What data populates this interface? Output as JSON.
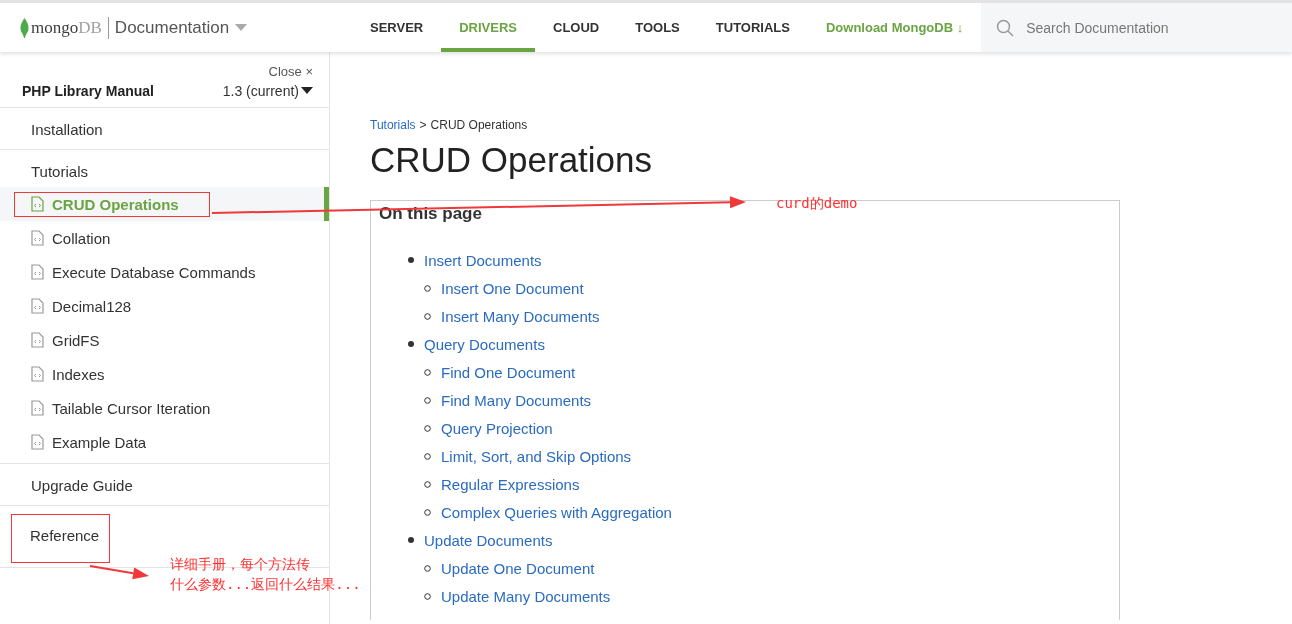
{
  "header": {
    "logo": {
      "word": "mongo",
      "suffix": "DB"
    },
    "section": "Documentation",
    "nav": [
      {
        "label": "SERVER",
        "selected": false
      },
      {
        "label": "DRIVERS",
        "selected": true
      },
      {
        "label": "CLOUD",
        "selected": false
      },
      {
        "label": "TOOLS",
        "selected": false
      },
      {
        "label": "TUTORIALS",
        "selected": false
      }
    ],
    "download": "Download MongoDB ↓",
    "search": {
      "placeholder": "Search Documentation"
    }
  },
  "sidebar": {
    "close": "Close ×",
    "title": "PHP Library Manual",
    "version": "1.3 (current)",
    "sections": [
      {
        "label": "Installation",
        "marked": false
      },
      {
        "label": "Tutorials",
        "marked": false,
        "children": [
          {
            "label": "CRUD Operations",
            "selected": true,
            "marked": true
          },
          {
            "label": "Collation",
            "selected": false,
            "marked": false
          },
          {
            "label": "Execute Database Commands",
            "selected": false,
            "marked": false
          },
          {
            "label": "Decimal128",
            "selected": false,
            "marked": false
          },
          {
            "label": "GridFS",
            "selected": false,
            "marked": false
          },
          {
            "label": "Indexes",
            "selected": false,
            "marked": false
          },
          {
            "label": "Tailable Cursor Iteration",
            "selected": false,
            "marked": false
          },
          {
            "label": "Example Data",
            "selected": false,
            "marked": false
          }
        ]
      },
      {
        "label": "Upgrade Guide",
        "marked": false
      },
      {
        "label": "Reference",
        "marked": true
      }
    ]
  },
  "breadcrumb": {
    "items": [
      "Tutorials",
      "CRUD Operations"
    ],
    "separator": ">"
  },
  "title": "CRUD Operations",
  "toc": {
    "heading": "On this page",
    "items": [
      {
        "label": "Insert Documents",
        "children": [
          {
            "label": "Insert One Document"
          },
          {
            "label": "Insert Many Documents"
          }
        ]
      },
      {
        "label": "Query Documents",
        "children": [
          {
            "label": "Find One Document"
          },
          {
            "label": "Find Many Documents"
          },
          {
            "label": "Query Projection"
          },
          {
            "label": "Limit, Sort, and Skip Options"
          },
          {
            "label": "Regular Expressions"
          },
          {
            "label": "Complex Queries with Aggregation"
          }
        ]
      },
      {
        "label": "Update Documents",
        "children": [
          {
            "label": "Update One Document"
          },
          {
            "label": "Update Many Documents"
          }
        ]
      }
    ]
  },
  "notes": [
    {
      "lines": [
        "curd的demo"
      ]
    },
    {
      "lines": [
        "详细手册，每个方法传",
        "什么参数...返回什么结果..."
      ]
    }
  ]
}
